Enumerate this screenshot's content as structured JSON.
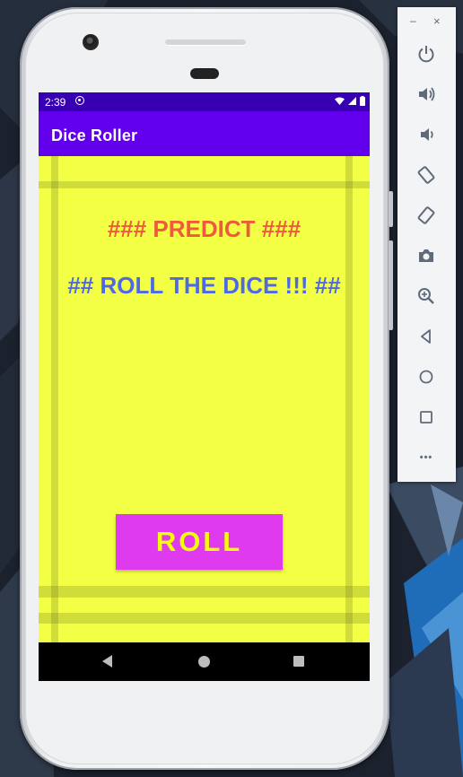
{
  "status_bar": {
    "time": "2:39"
  },
  "app_bar": {
    "title": "Dice Roller"
  },
  "content": {
    "predict_text": "### PREDICT ###",
    "roll_dice_text": "## ROLL THE DICE !!! ##",
    "roll_button_label": "ROLL"
  },
  "emulator_toolbar": {
    "minimize_label": "–",
    "close_label": "×",
    "more_label": "•••",
    "buttons": [
      "power-icon",
      "volume-up-icon",
      "volume-down-icon",
      "rotate-left-icon",
      "rotate-right-icon",
      "camera-icon",
      "zoom-icon",
      "back-icon",
      "home-icon",
      "overview-icon",
      "more-icon"
    ]
  },
  "colors": {
    "status_bar": "#3700b3",
    "app_bar": "#6200ee",
    "content_bg": "#f2ff44",
    "predict_text": "#f05a3c",
    "roll_dice_text": "#4f68e6",
    "roll_button_bg": "#e03aef",
    "roll_button_text": "#f2ff00"
  }
}
